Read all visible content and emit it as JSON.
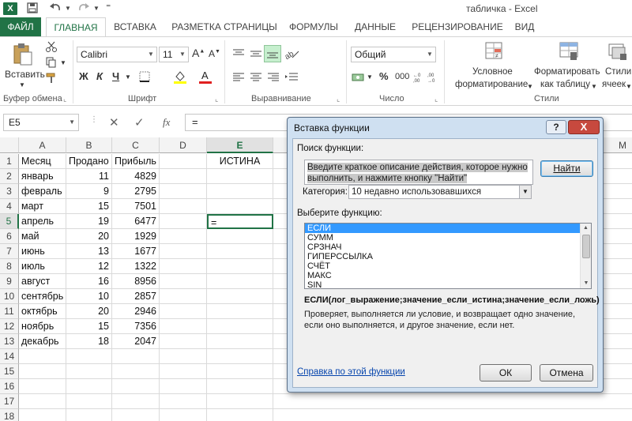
{
  "window": {
    "title": "табличка - Excel"
  },
  "quick_access": {
    "app_icon": "X",
    "save_icon": "save-icon",
    "undo_icon": "undo-icon",
    "redo_icon": "redo-icon"
  },
  "ribbon_tabs": [
    "ФАЙЛ",
    "ГЛАВНАЯ",
    "ВСТАВКА",
    "РАЗМЕТКА СТРАНИЦЫ",
    "ФОРМУЛЫ",
    "ДАННЫЕ",
    "РЕЦЕНЗИРОВАНИЕ",
    "ВИД"
  ],
  "ribbon": {
    "paste_label": "Вставить",
    "font_name": "Calibri",
    "font_size": "11",
    "bold": "Ж",
    "italic": "К",
    "underline": "Ч",
    "number_format": "Общий",
    "percent": "%",
    "thousands": "000",
    "cond_format_line1": "Условное",
    "cond_format_line2": "форматирование",
    "format_table_line1": "Форматировать",
    "format_table_line2": "как таблицу",
    "styles_line1": "Стили",
    "styles_line2": "ячеек",
    "groups": {
      "clipboard": "Буфер обмена",
      "font": "Шрифт",
      "alignment": "Выравнивание",
      "number": "Число",
      "styles": "Стили"
    }
  },
  "formula_bar": {
    "name_box": "E5",
    "fx": "fx",
    "content": "="
  },
  "sheet": {
    "columns": [
      "A",
      "B",
      "C",
      "D",
      "E"
    ],
    "extra_column": "M",
    "rows": [
      "1",
      "2",
      "3",
      "4",
      "5",
      "6",
      "7",
      "8",
      "9",
      "10",
      "11",
      "12",
      "13",
      "14",
      "15",
      "16",
      "17",
      "18"
    ],
    "headers": [
      "Месяц",
      "Продано",
      "Прибыль"
    ],
    "e1": "ИСТИНА",
    "e5": "=",
    "data": [
      [
        "январь",
        "11",
        "4829"
      ],
      [
        "февраль",
        "9",
        "2795"
      ],
      [
        "март",
        "15",
        "7501"
      ],
      [
        "апрель",
        "19",
        "6477"
      ],
      [
        "май",
        "20",
        "1929"
      ],
      [
        "июнь",
        "13",
        "1677"
      ],
      [
        "июль",
        "12",
        "1322"
      ],
      [
        "август",
        "16",
        "8956"
      ],
      [
        "сентябрь",
        "10",
        "2857"
      ],
      [
        "октябрь",
        "20",
        "2946"
      ],
      [
        "ноябрь",
        "15",
        "7356"
      ],
      [
        "декабрь",
        "18",
        "2047"
      ]
    ]
  },
  "dialog": {
    "title": "Вставка функции",
    "help_btn": "?",
    "close_btn": "X",
    "search_label": "Поиск функции:",
    "search_text": "Введите краткое описание действия, которое нужно выполнить, и нажмите кнопку \"Найти\"",
    "find_btn": "Найти",
    "category_label": "Категория:",
    "category_value": "10 недавно использовавшихся",
    "select_label": "Выберите функцию:",
    "functions": [
      "ЕСЛИ",
      "СУММ",
      "СРЗНАЧ",
      "ГИПЕРССЫЛКА",
      "СЧЁТ",
      "МАКС",
      "SIN"
    ],
    "selected_function": "ЕСЛИ",
    "signature": "ЕСЛИ(лог_выражение;значение_если_истина;значение_если_ложь)",
    "description": "Проверяет, выполняется ли условие, и возвращает одно значение, если оно выполняется, и другое значение, если нет.",
    "help_link": "Справка по этой функции",
    "ok_btn": "ОК",
    "cancel_btn": "Отмена"
  }
}
